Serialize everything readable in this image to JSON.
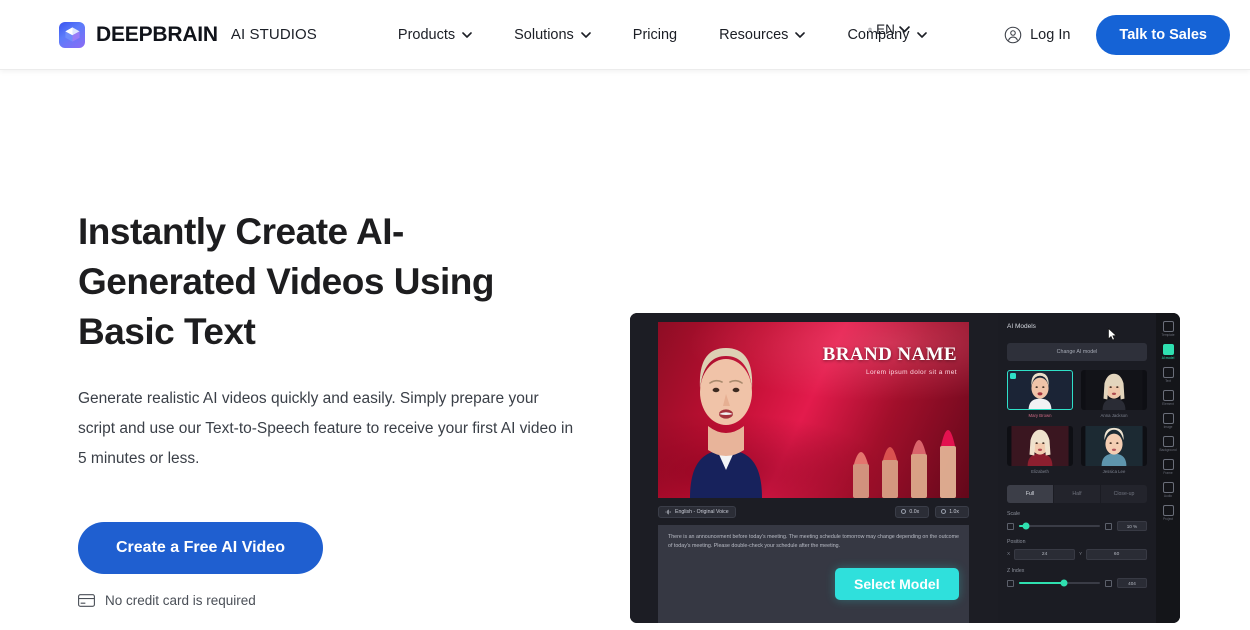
{
  "header": {
    "logo_icon": "cube-logo-icon",
    "brand_name": "DEEPBRAIN",
    "brand_sub": "AI STUDIOS",
    "nav": [
      {
        "label": "Products",
        "has_menu": true
      },
      {
        "label": "Solutions",
        "has_menu": true
      },
      {
        "label": "Pricing",
        "has_menu": false
      },
      {
        "label": "Resources",
        "has_menu": true
      },
      {
        "label": "Company",
        "has_menu": true
      }
    ],
    "language": {
      "icon": "globe-icon",
      "label": "EN",
      "chevron": "chevron-down-icon"
    },
    "login": {
      "icon": "user-circle-icon",
      "label": "Log In"
    },
    "cta": {
      "label": "Talk to Sales",
      "color": "#1563d6"
    }
  },
  "hero": {
    "title": "Instantly Create AI-Generated Videos Using Basic Text",
    "subtitle": "Generate realistic AI videos quickly and easily. Simply prepare your script and use our Text-to-Speech feature to receive your first AI video in 5 minutes or less.",
    "cta_label": "Create a Free AI Video",
    "cta_color": "#1f5fd0",
    "note_icon": "credit-card-icon",
    "note": "No credit card is required"
  },
  "product": {
    "canvas": {
      "brand_headline": "BRAND NAME",
      "brand_tagline": "Lorem ipsum dolor sit a met"
    },
    "toolbar": {
      "voice_icon": "voice-wave-icon",
      "voice_label": "English - Original Voice",
      "chips": [
        {
          "icon": "clock-icon",
          "value": "0.0x"
        },
        {
          "icon": "speed-icon",
          "value": "1.0x"
        }
      ]
    },
    "script_text": "There is an announcement before today's meeting. The meeting schedule tomorrow may change depending on the outcome of today's meeting. Please double-check your schedule after the meeting.",
    "select_model_label": "Select Model",
    "select_model_color": "#2fe0dc",
    "panel": {
      "title": "AI Models",
      "change_model_label": "Change AI model",
      "models": [
        {
          "label": "Mary Brown",
          "selected": true,
          "bg": "#1b2436",
          "hair": "#e8dcc8",
          "cloth": "#f2f2f4"
        },
        {
          "label": "Anna Jackson",
          "selected": false,
          "bg": "#121318",
          "hair": "#e3d5bd",
          "cloth": "#2a2c35"
        },
        {
          "label": "Elizabeth",
          "selected": false,
          "bg": "#3a1620",
          "hair": "#efe2cd",
          "cloth": "#8d1f2f"
        },
        {
          "label": "Jessica Lee",
          "selected": false,
          "bg": "#1c2a33",
          "hair": "#efe4d1",
          "cloth": "#5e95ad"
        }
      ],
      "tabs": [
        {
          "label": "Full",
          "active": true
        },
        {
          "label": "Half",
          "active": false
        },
        {
          "label": "Close-up",
          "active": false
        }
      ],
      "controls": [
        {
          "label": "Scale",
          "type": "slider",
          "fill_pct": 9,
          "knob_pct": 9,
          "value": "10 %",
          "left_icon": "scale-icon",
          "right_icon": "lock-icon"
        },
        {
          "label": "Position",
          "type": "pair",
          "x_axis": "X",
          "x_value": "24",
          "y_axis": "Y",
          "y_value": "60"
        },
        {
          "label": "Z Index",
          "type": "slider",
          "fill_pct": 55,
          "knob_pct": 55,
          "value": "404",
          "left_icon": "layers-icon",
          "right_icon": "layers-front-icon"
        }
      ]
    },
    "rail": [
      {
        "icon": "templates-icon",
        "label": "Template",
        "active": false
      },
      {
        "icon": "ai-model-icon",
        "label": "AI model",
        "active": true
      },
      {
        "icon": "text-icon",
        "label": "Text",
        "active": false
      },
      {
        "icon": "element-icon",
        "label": "Element",
        "active": false
      },
      {
        "icon": "image-icon",
        "label": "Image",
        "active": false
      },
      {
        "icon": "background-icon",
        "label": "Background",
        "active": false
      },
      {
        "icon": "frame-icon",
        "label": "Frame",
        "active": false
      },
      {
        "icon": "audio-icon",
        "label": "Audio",
        "active": false
      },
      {
        "icon": "project-icon",
        "label": "Project",
        "active": false
      }
    ],
    "cursor_icon": "mouse-pointer-icon"
  }
}
